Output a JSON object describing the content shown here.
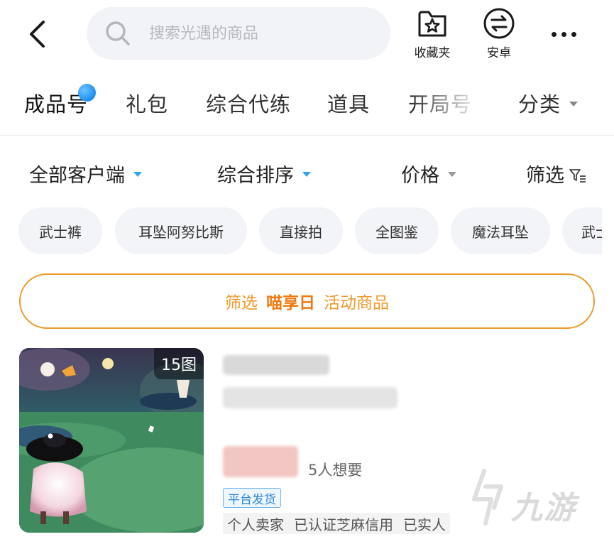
{
  "header": {
    "back_icon": "chevron-left-icon",
    "search": {
      "placeholder": "搜索光遇的商品",
      "value": "",
      "icon": "search-icon"
    },
    "favorites": {
      "label": "收藏夹",
      "icon": "star-folder-icon"
    },
    "android": {
      "label": "安卓",
      "icon": "swap-circle-icon"
    },
    "more_icon": "more-dots-icon"
  },
  "tabs": [
    {
      "label": "成品号",
      "active": true,
      "has_dot": true
    },
    {
      "label": "礼包"
    },
    {
      "label": "综合代练"
    },
    {
      "label": "道具"
    },
    {
      "label": "开局号"
    },
    {
      "label": "分类",
      "dropdown": true
    }
  ],
  "sort": {
    "client": "全部客户端",
    "order": "综合排序",
    "price": "价格",
    "filter": "筛选"
  },
  "chips": [
    "武士裤",
    "耳坠阿努比斯",
    "直接拍",
    "全图鉴",
    "魔法耳坠",
    "武士"
  ],
  "banner": {
    "prefix": "筛选",
    "highlight": "喵享日",
    "suffix": "活动商品"
  },
  "product": {
    "photo_count": "15图",
    "want_count": "5人想要",
    "ship_badge": "平台发货",
    "seller_tags": [
      "个人卖家",
      "已认证芝麻信用",
      "已实人"
    ]
  },
  "watermark": "九游",
  "colors": {
    "accent_blue": "#2aa6f2",
    "promo_orange": "#ef9a2a",
    "promo_highlight": "#f07a10",
    "badge_blue": "#2a86d8"
  }
}
